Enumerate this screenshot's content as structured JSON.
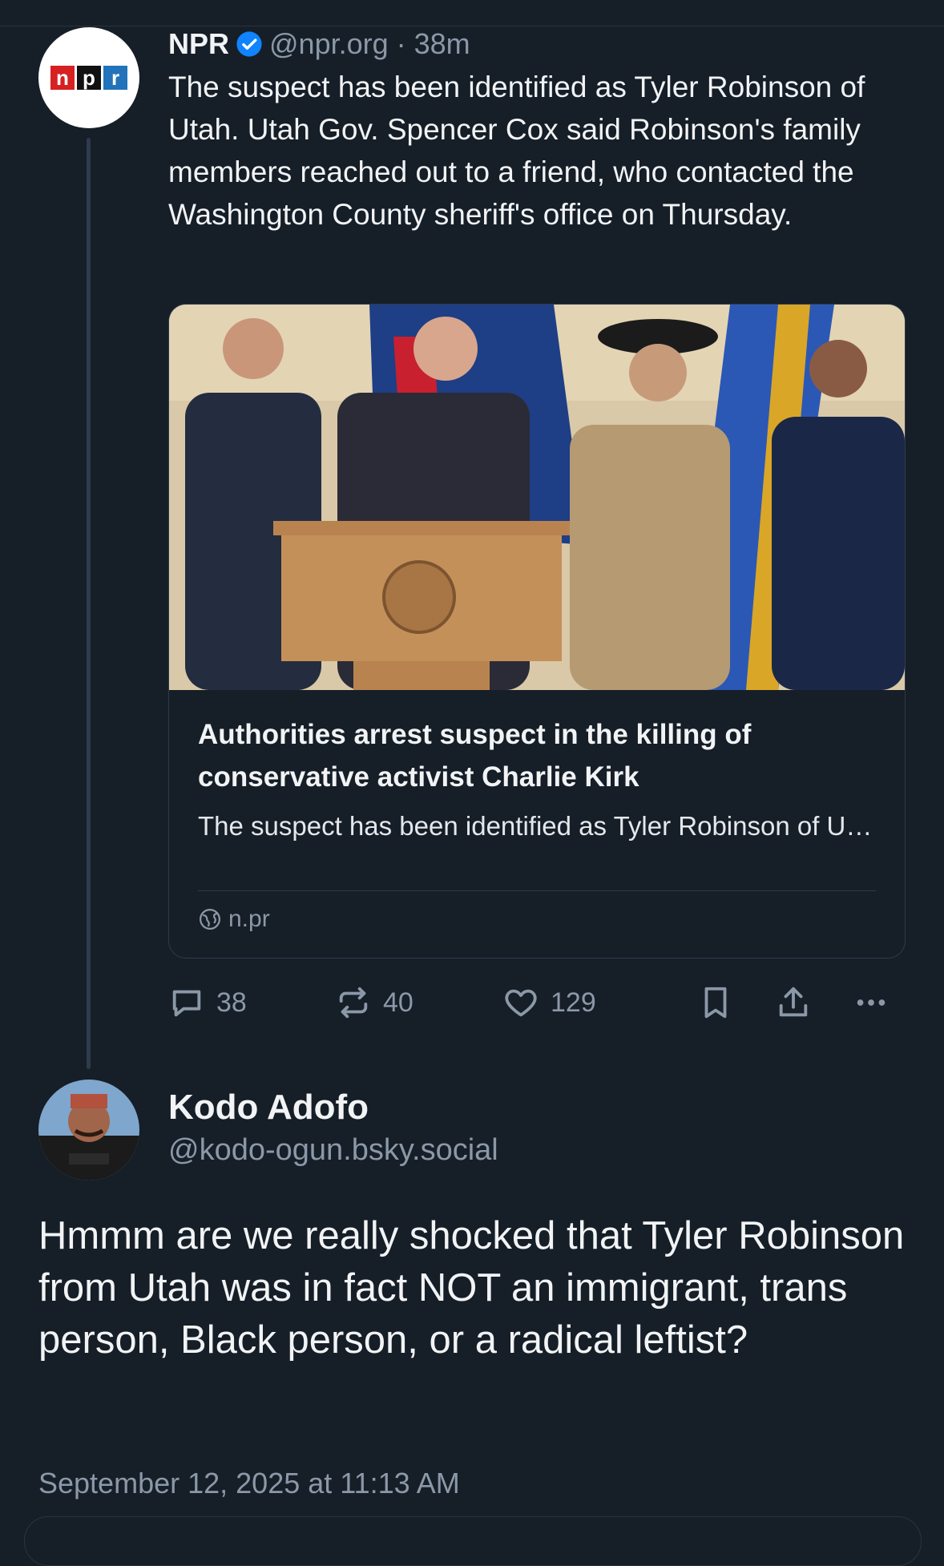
{
  "post": {
    "author_name": "NPR",
    "avatar_letters": [
      "n",
      "p",
      "r"
    ],
    "handle": "@npr.org",
    "separator": "·",
    "time": "38m",
    "text": "The suspect has been identified as Tyler Robinson of Utah. Utah Gov. Spencer Cox said Robinson's family members reached out to a friend, who contacted the Washington County sheriff's office on Thursday.",
    "link_card": {
      "title": "Authorities arrest suspect in the killing of conservative activist Charlie Kirk",
      "description": "The suspect has been identified as Tyler Robinson of Utah. Utah Gov. Spencer Cox said...",
      "domain": "n.pr"
    },
    "actions": {
      "replies": "38",
      "reposts": "40",
      "likes": "129"
    }
  },
  "reply": {
    "author_name": "Kodo Adofo",
    "handle": "@kodo-ogun.bsky.social",
    "text": "Hmmm are we really shocked that Tyler Robinson from Utah was in fact NOT an immigrant, trans person, Black person, or a radical leftist?",
    "date": "September 12, 2025 at 11:13 AM"
  },
  "colors": {
    "background": "#161e27",
    "text": "#f1f3f5",
    "muted": "#8b98a8",
    "verified": "#1083fe",
    "npr_red": "#d62021",
    "npr_black": "#111111",
    "npr_blue": "#2273ba"
  }
}
